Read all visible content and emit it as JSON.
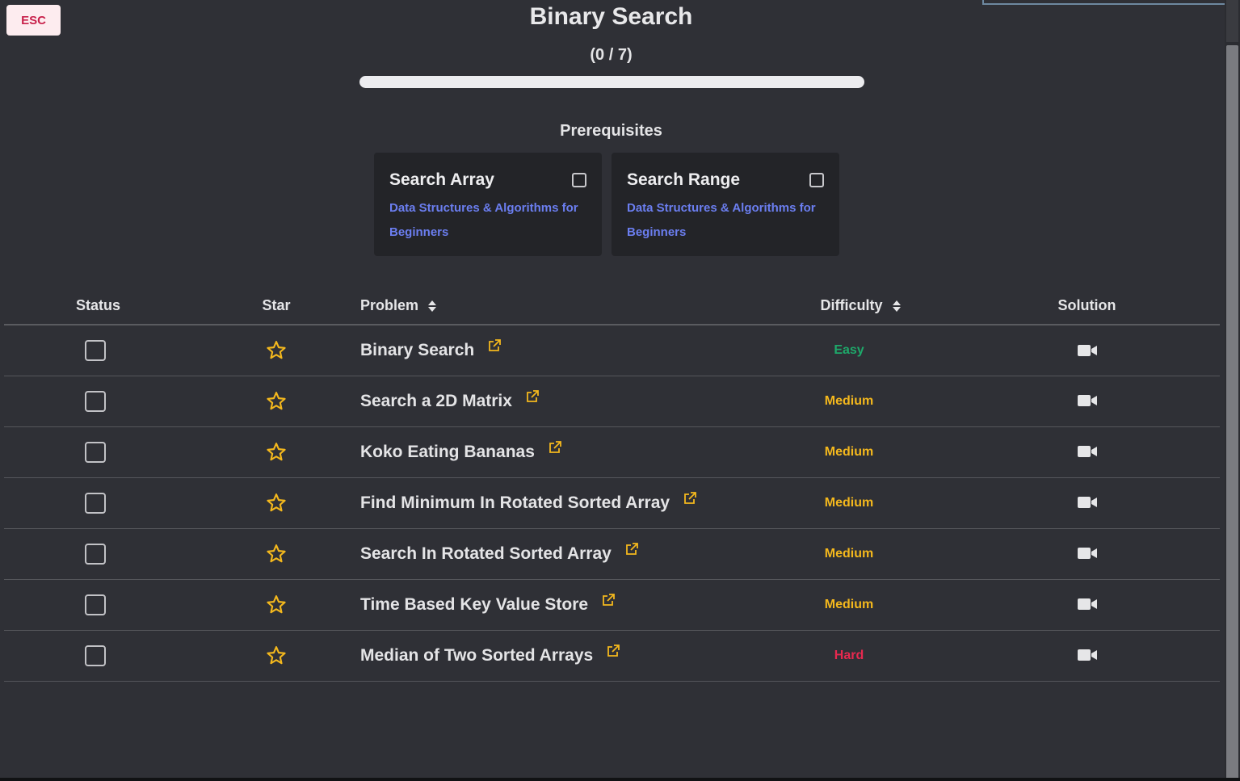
{
  "header": {
    "esc_label": "ESC",
    "title": "Binary Search",
    "progress_text": "(0 / 7)",
    "progress_fraction": 0
  },
  "prerequisites": {
    "title": "Prerequisites",
    "cards": [
      {
        "title": "Search Array",
        "course": "Data Structures & Algorithms for Beginners",
        "checked": false
      },
      {
        "title": "Search Range",
        "course": "Data Structures & Algorithms for Beginners",
        "checked": false
      }
    ]
  },
  "table": {
    "headers": {
      "status": "Status",
      "star": "Star",
      "problem": "Problem",
      "difficulty": "Difficulty",
      "solution": "Solution"
    },
    "rows": [
      {
        "problem": "Binary Search",
        "difficulty": "Easy",
        "done": false,
        "starred": false
      },
      {
        "problem": "Search a 2D Matrix",
        "difficulty": "Medium",
        "done": false,
        "starred": false
      },
      {
        "problem": "Koko Eating Bananas",
        "difficulty": "Medium",
        "done": false,
        "starred": false
      },
      {
        "problem": "Find Minimum In Rotated Sorted Array",
        "difficulty": "Medium",
        "done": false,
        "starred": false
      },
      {
        "problem": "Search In Rotated Sorted Array",
        "difficulty": "Medium",
        "done": false,
        "starred": false
      },
      {
        "problem": "Time Based Key Value Store",
        "difficulty": "Medium",
        "done": false,
        "starred": false
      },
      {
        "problem": "Median of Two Sorted Arrays",
        "difficulty": "Hard",
        "done": false,
        "starred": false
      }
    ]
  },
  "colors": {
    "background": "#2f3036",
    "card": "#232428",
    "link": "#6b7ef0",
    "easy": "#1ea86a",
    "medium": "#f4b81d",
    "hard": "#e7294f",
    "star": "#f4b81d"
  },
  "icons": {
    "sort": "sort-icon",
    "star": "star-outline-icon",
    "external_link": "external-link-icon",
    "solution": "video-camera-icon"
  }
}
